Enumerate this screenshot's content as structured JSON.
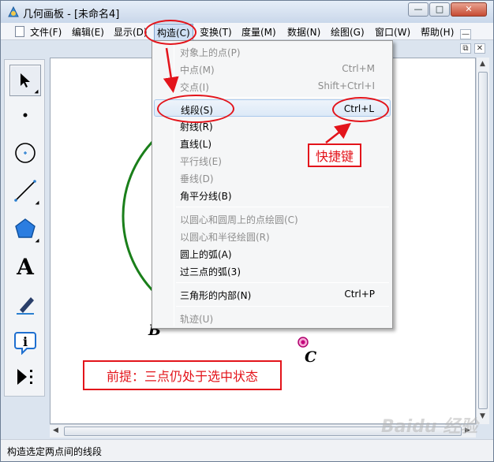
{
  "window": {
    "title": "几何画板 - [未命名4]",
    "buttons": {
      "minimize": "—",
      "maximize": "□",
      "close": "✕"
    }
  },
  "menubar": {
    "items": [
      "文件(F)",
      "编辑(E)",
      "显示(D)",
      "构造(C)",
      "变换(T)",
      "度量(M)",
      "数据(N)",
      "绘图(G)",
      "窗口(W)",
      "帮助(H)"
    ],
    "active": "构造(C)",
    "mdi": {
      "minimize": "—",
      "restore": "⧉",
      "close": "✕"
    }
  },
  "toolbox": {
    "tools": [
      "arrow-tool",
      "point-tool",
      "compass-tool",
      "straightedge-tool",
      "polygon-tool",
      "text-tool",
      "marker-tool",
      "information-tool",
      "custom-tool"
    ],
    "text_tool_glyph": "A",
    "info_tool_glyph": "i"
  },
  "construct_menu": {
    "items": [
      {
        "label": "对象上的点(P)",
        "shortcut": "",
        "enabled": false
      },
      {
        "label": "中点(M)",
        "shortcut": "Ctrl+M",
        "enabled": false
      },
      {
        "label": "交点(I)",
        "shortcut": "Shift+Ctrl+I",
        "enabled": false
      },
      {
        "label": "线段(S)",
        "shortcut": "Ctrl+L",
        "enabled": true,
        "highlighted": true
      },
      {
        "label": "射线(R)",
        "shortcut": "",
        "enabled": true
      },
      {
        "label": "直线(L)",
        "shortcut": "",
        "enabled": true
      },
      {
        "label": "平行线(E)",
        "shortcut": "",
        "enabled": false
      },
      {
        "label": "垂线(D)",
        "shortcut": "",
        "enabled": false
      },
      {
        "label": "角平分线(B)",
        "shortcut": "",
        "enabled": true
      },
      {
        "label": "以圆心和圆周上的点绘圆(C)",
        "shortcut": "",
        "enabled": false
      },
      {
        "label": "以圆心和半径绘圆(R)",
        "shortcut": "",
        "enabled": false
      },
      {
        "label": "圆上的弧(A)",
        "shortcut": "",
        "enabled": true
      },
      {
        "label": "过三点的弧(3)",
        "shortcut": "",
        "enabled": true
      },
      {
        "label": "三角形的内部(N)",
        "shortcut": "Ctrl+P",
        "enabled": true
      },
      {
        "label": "轨迹(U)",
        "shortcut": "",
        "enabled": false
      }
    ]
  },
  "canvas": {
    "circle_color": "#1a7f1a",
    "points": [
      {
        "label": "B"
      },
      {
        "label": "C"
      }
    ]
  },
  "annotations": {
    "shortcut_label": "快捷键",
    "premise_label": "前提：三点仍处于选中状态",
    "color": "#e3141b"
  },
  "statusbar": {
    "text": "构造选定两点间的线段"
  },
  "watermark": "Baidu 经验"
}
